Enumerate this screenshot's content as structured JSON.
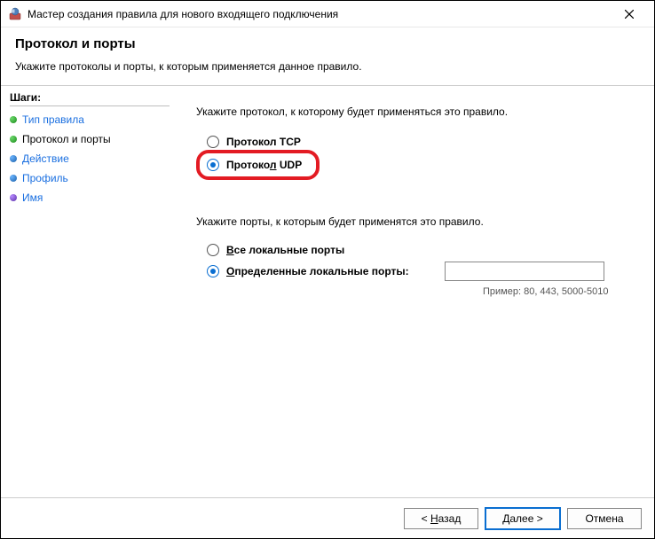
{
  "titlebar": {
    "title": "Мастер создания правила для нового входящего подключения"
  },
  "header": {
    "title": "Протокол и порты",
    "subtitle": "Укажите протоколы и порты, к которым применяется данное правило."
  },
  "sidebar": {
    "heading": "Шаги:",
    "steps": [
      {
        "label": "Тип правила",
        "bullet": "green",
        "state": "link"
      },
      {
        "label": "Протокол и порты",
        "bullet": "green",
        "state": "current"
      },
      {
        "label": "Действие",
        "bullet": "blue",
        "state": "link"
      },
      {
        "label": "Профиль",
        "bullet": "blue",
        "state": "link"
      },
      {
        "label": "Имя",
        "bullet": "purple",
        "state": "link"
      }
    ]
  },
  "content": {
    "protocol_prompt": "Укажите протокол, к которому будет применяться это правило.",
    "tcp_label": "Протокол TCP",
    "udp_label_prefix": "Протоко",
    "udp_label_u": "л",
    "udp_label_suffix": " UDP",
    "ports_prompt": "Укажите порты, к которым будет применятся это правило.",
    "all_ports_prefix": "",
    "all_ports_u": "В",
    "all_ports_suffix": "се локальные порты",
    "specific_ports_prefix": "",
    "specific_ports_u": "О",
    "specific_ports_suffix": "пределенные локальные порты:",
    "ports_value": "",
    "example": "Пример: 80, 443, 5000-5010"
  },
  "footer": {
    "back_prefix": "< ",
    "back_u": "Н",
    "back_suffix": "азад",
    "next_prefix": "",
    "next_u": "Д",
    "next_suffix": "алее >",
    "cancel": "Отмена"
  }
}
